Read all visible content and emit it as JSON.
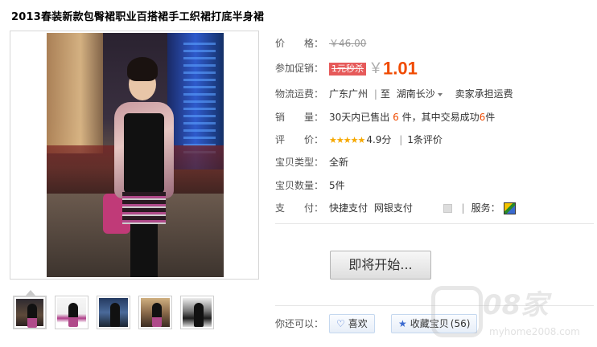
{
  "product": {
    "title": "2013春装新款包臀裙职业百搭裙手工织裙打底半身裙"
  },
  "price": {
    "label": "价　　格：",
    "original": "￥46.00",
    "promo_label": "参加促销：",
    "promo_tag": "1元秒杀",
    "currency": "￥",
    "current": "1.01"
  },
  "shipping": {
    "label": "物流运费：",
    "from": "广东广州",
    "sep": "|",
    "to_prefix": "至",
    "to": "湖南长沙",
    "note": "卖家承担运费"
  },
  "sales": {
    "label": "销　　量：",
    "prefix": "30天内已售出",
    "sold": "6",
    "mid": "件，其中交易成功",
    "success": "6",
    "suffix": "件"
  },
  "rating": {
    "label": "评　　价：",
    "stars": "★★★★★",
    "score": "4.9分",
    "sep": "|",
    "count": "1条评价"
  },
  "condition": {
    "label": "宝贝类型：",
    "value": "全新"
  },
  "quantity": {
    "label": "宝贝数量：",
    "value": "5件"
  },
  "payment": {
    "label": "支　　付：",
    "method1": "快捷支付",
    "method2": "网银支付",
    "sep": "|",
    "service_label": "服务："
  },
  "actions": {
    "buy_label": "即将开始...",
    "share_label": "你还可以：",
    "like_label": "喜欢",
    "fav_label": "收藏宝贝",
    "fav_count": "(56)"
  },
  "watermark": {
    "text": "08家",
    "url": "myhome2008.com"
  },
  "colors": {
    "accent": "#f04a00",
    "promo_bg": "#e65a5a",
    "star": "#f6a800",
    "link_blue": "#3a6ad0"
  },
  "icons": [
    "heart-icon",
    "star-icon",
    "service-icon",
    "chevron-down-icon"
  ]
}
